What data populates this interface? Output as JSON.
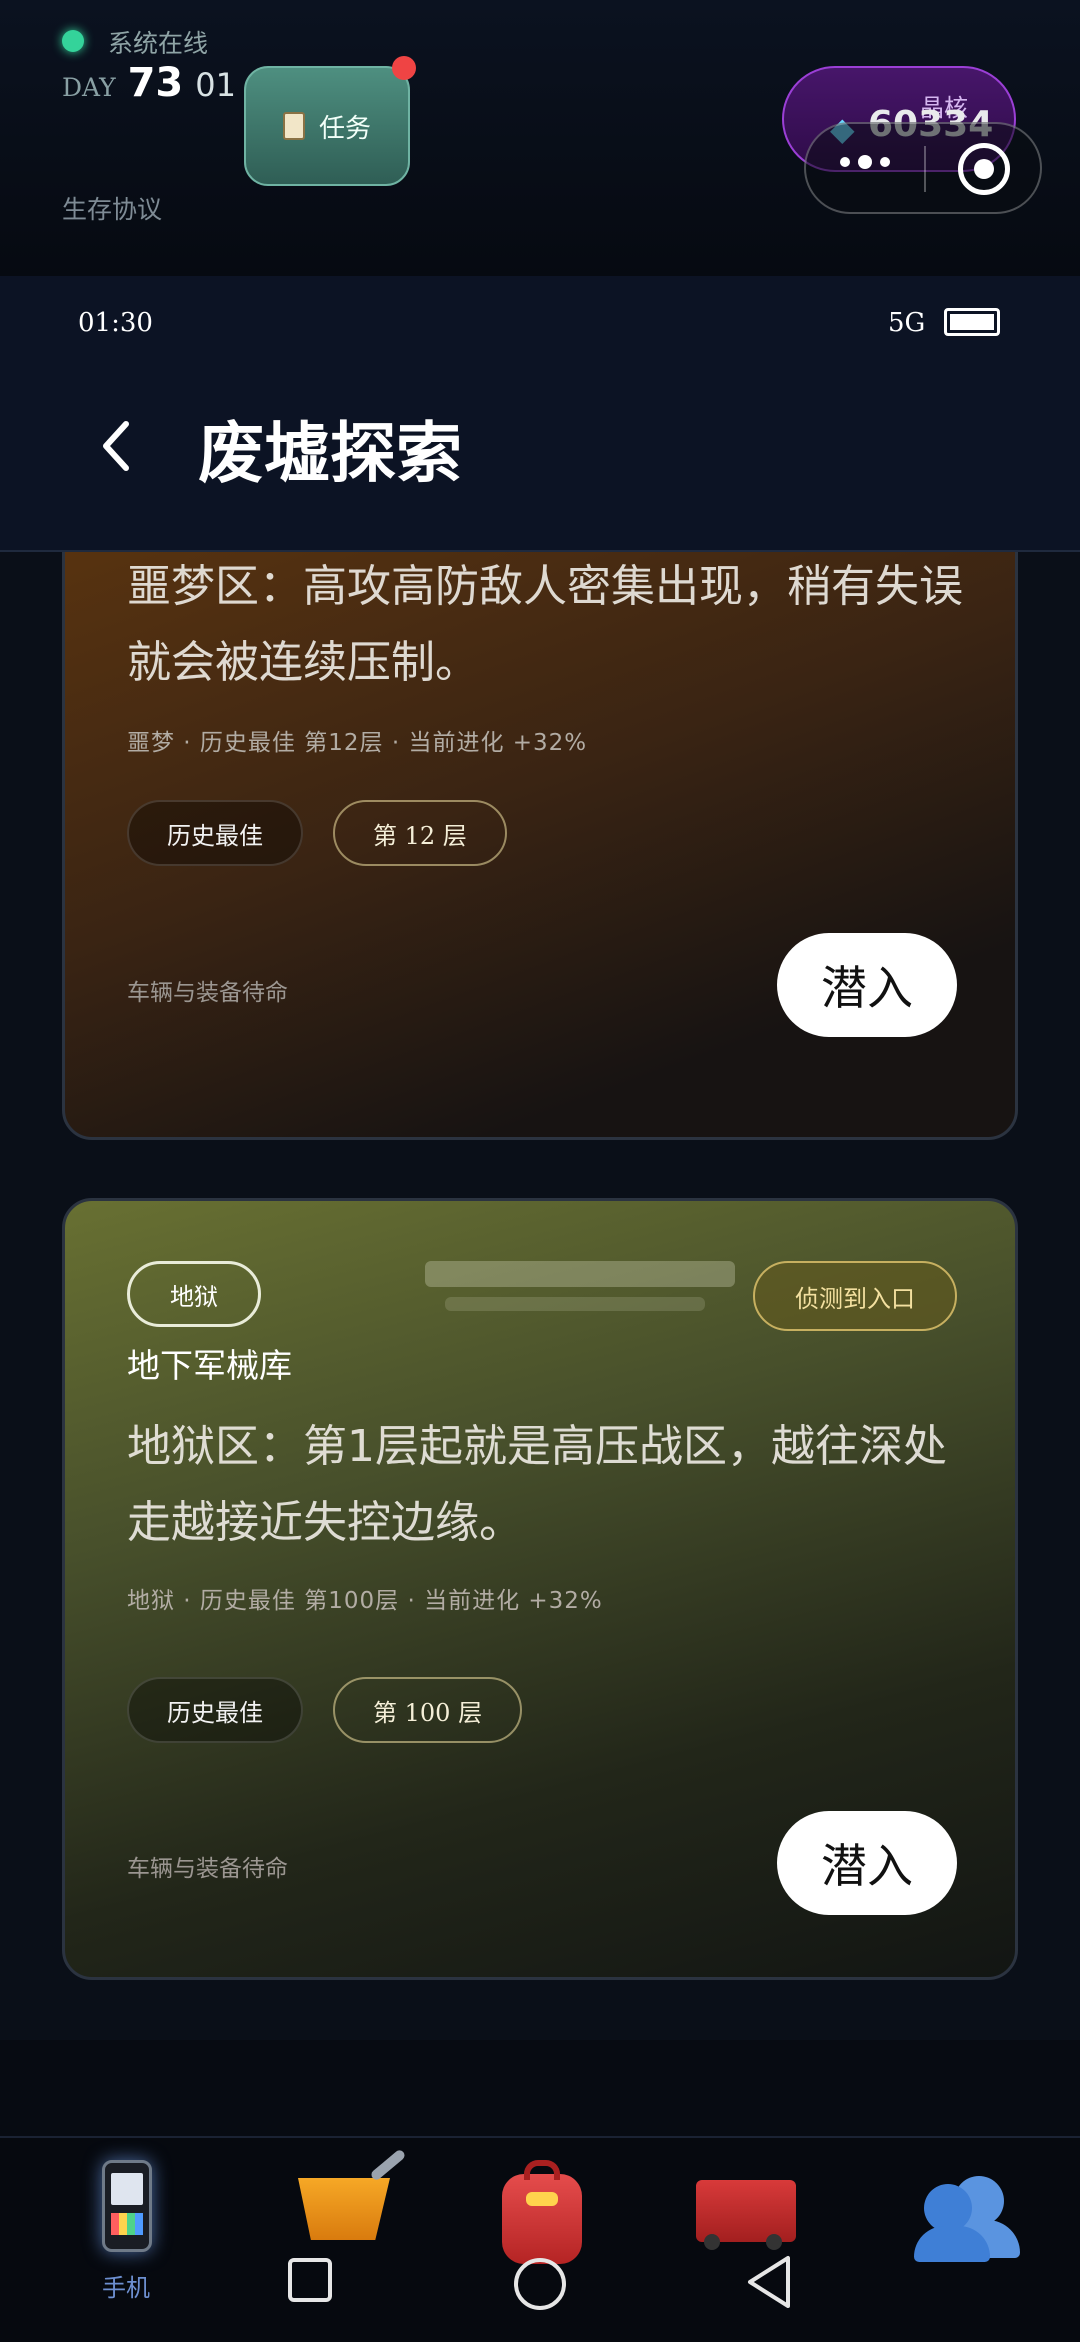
{
  "hud": {
    "status": "系统在线",
    "day_label": "DAY",
    "day_number": "73",
    "day_sub": "01",
    "protocol": "生存协议",
    "task_label": "任务",
    "gem_label": "晶核",
    "gem_value": "60334"
  },
  "statusbar": {
    "time": "01:30",
    "network": "5G"
  },
  "header": {
    "title": "废墟探索"
  },
  "cards": [
    {
      "description": "噩梦区：高攻高防敌人密集出现，稍有失误就会被连续压制。",
      "meta": "噩梦 · 历史最佳 第12层 · 当前进化 +32%",
      "chip_best": "历史最佳",
      "chip_floor": "第 12 层",
      "footer": "车辆与装备待命",
      "button": "潜入"
    },
    {
      "tag": "地狱",
      "detect": "侦测到入口",
      "name": "地下军械库",
      "description": "地狱区：第1层起就是高压战区，越往深处走越接近失控边缘。",
      "meta": "地狱 · 历史最佳 第100层 · 当前进化 +32%",
      "chip_best": "历史最佳",
      "chip_floor": "第 100 层",
      "footer": "车辆与装备待命",
      "button": "潜入"
    }
  ],
  "bottom_nav": {
    "items": [
      {
        "label": "手机",
        "icon": "phone-icon",
        "active": true
      },
      {
        "icon": "cart-icon"
      },
      {
        "icon": "backpack-icon"
      },
      {
        "icon": "truck-icon"
      },
      {
        "icon": "users-icon"
      }
    ]
  },
  "colors": {
    "accent_active": "#6d8fd0",
    "online_dot": "#34d39a",
    "gem_pill": "#47166a"
  }
}
